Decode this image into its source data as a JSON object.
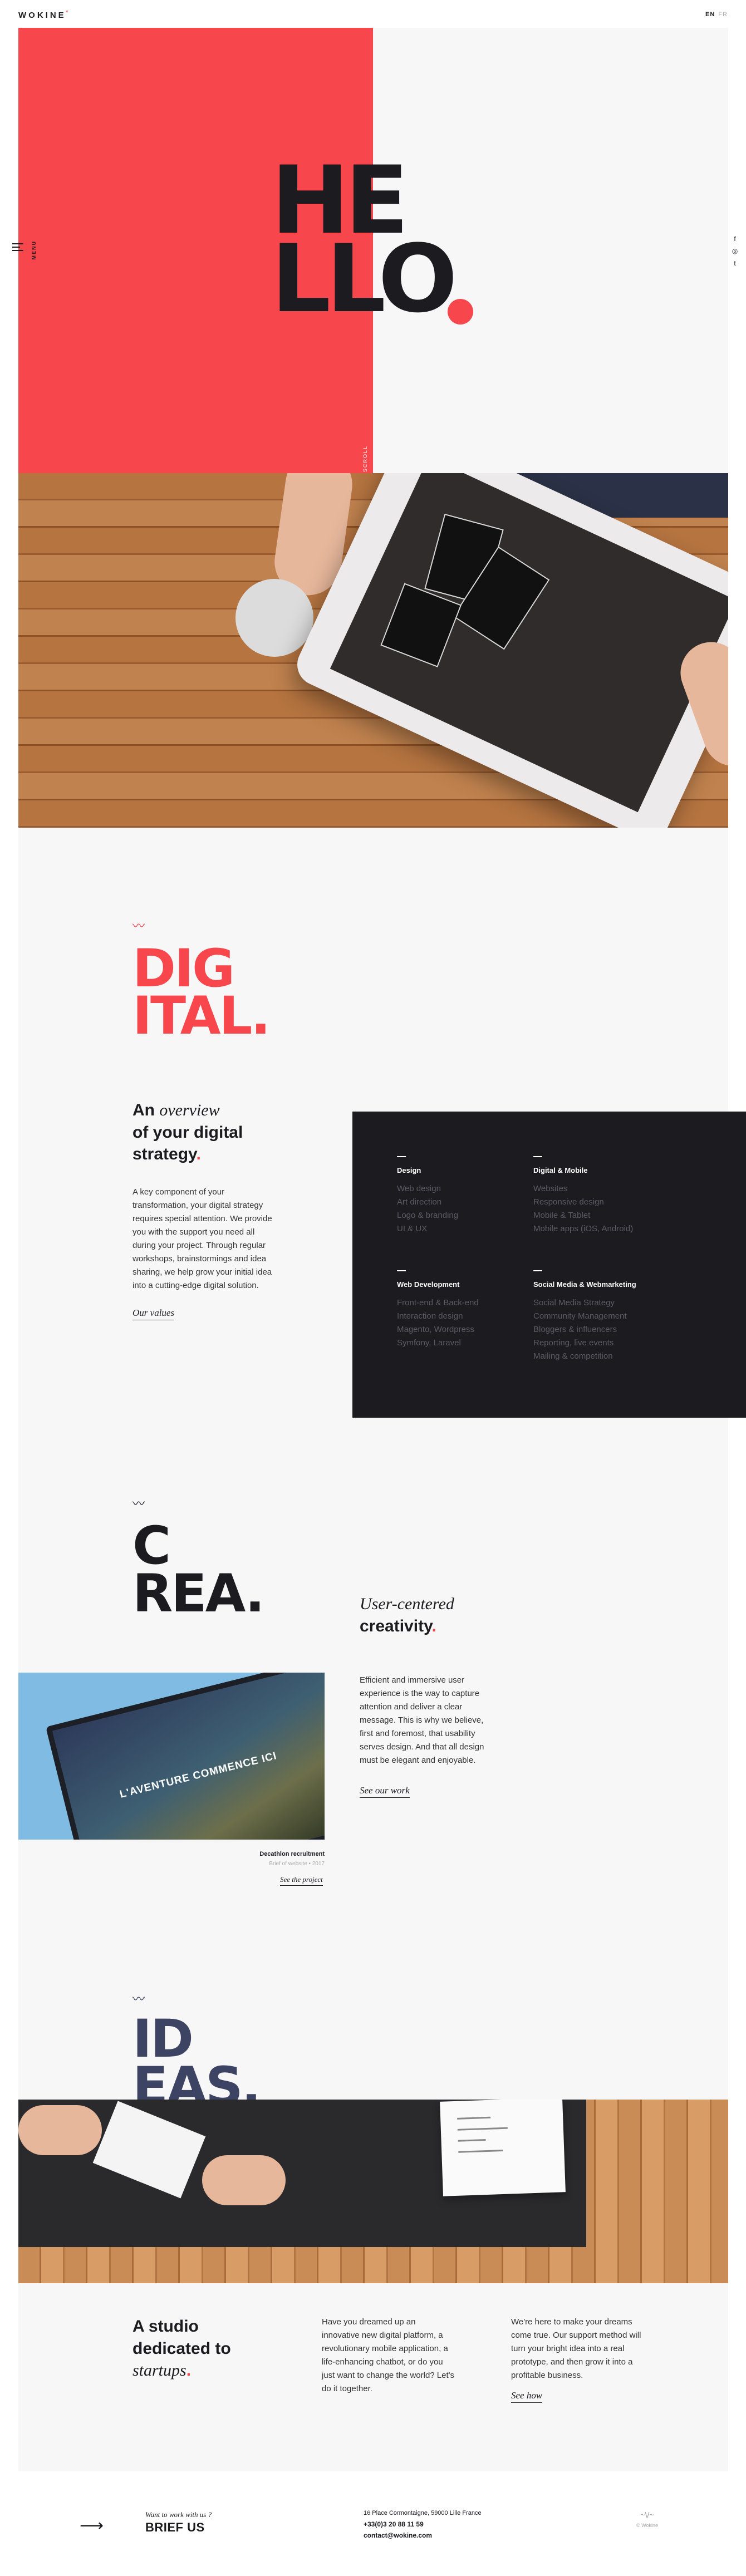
{
  "header": {
    "logo": "WOKINE",
    "logo_mark": "°",
    "lang_active": "EN",
    "lang_other": "FR"
  },
  "hero": {
    "line1": "HE",
    "line2": "LLO",
    "side_text": "MENU",
    "scroll_text": "SCROLL",
    "social": [
      "f",
      "◎",
      "t"
    ],
    "colors": {
      "accent": "#f8464d",
      "dark": "#1c1b20",
      "light": "#f7f7f7"
    }
  },
  "digital": {
    "title1": "DIG",
    "title2": "ITAL",
    "heading_pre": "An",
    "heading_em": "overview",
    "heading_rest": "of your digital",
    "heading_last": "strategy",
    "body": "A key component of your transformation, your digital strategy requires special attention. We provide you with the support you need all during your project. Through regular workshops, brainstormings and idea sharing, we help grow your initial idea into a cutting-edge digital solution.",
    "link": "Our values",
    "services": [
      {
        "title": "Design",
        "items": [
          "Web design",
          "Art direction",
          "Logo & branding",
          "UI & UX"
        ]
      },
      {
        "title": "Digital & Mobile",
        "items": [
          "Websites",
          "Responsive design",
          "Mobile & Tablet",
          "Mobile apps (iOS, Android)"
        ]
      },
      {
        "title": "Web Development",
        "items": [
          "Front-end & Back-end",
          "Interaction design",
          "Magento, Wordpress",
          "Symfony, Laravel"
        ]
      },
      {
        "title": "Social Media & Webmarketing",
        "items": [
          "Social Media Strategy",
          "Community Management",
          "Bloggers & influencers",
          "Reporting, live events",
          "Mailing & competition"
        ]
      }
    ]
  },
  "crea": {
    "title1": "C",
    "title2": "REA",
    "heading_em": "User-centered",
    "heading_bold": "creativity",
    "body": "Efficient and immersive user experience is the way to capture attention and deliver a clear message. This is why we believe, first and foremost, that usability serves design. And that all design must be elegant and enjoyable.",
    "link": "See our work",
    "laptop_text": "L'AVENTURE COMMENCE ICI",
    "project_title": "Decathlon recruitment",
    "project_meta": "Brief of website   •   2017",
    "project_link": "See the project"
  },
  "ideas": {
    "title1": "ID",
    "title2": "EAS",
    "heading_1": "A studio",
    "heading_2": "dedicated to",
    "heading_em": "startups",
    "col1": "Have you dreamed up an innovative new digital platform, a revolutionary mobile application, a life-enhancing chatbot, or do you just want to change the world? Let's do it together.",
    "col2": "We're here to make your dreams come true. Our support method will turn your bright idea into a real prototype, and then grow it into a profitable business.",
    "link": "See how"
  },
  "footer": {
    "arrow": "⟶",
    "want": "Want to work with us ?",
    "brief": "BRIEF US",
    "address": "16 Place Cormontaigne, 59000 Lille France",
    "phone": "+33(0)3 20 88 11 59",
    "email": "contact@wokine.com",
    "mark": "~\\/~",
    "mark_caption": "© Wokine"
  }
}
